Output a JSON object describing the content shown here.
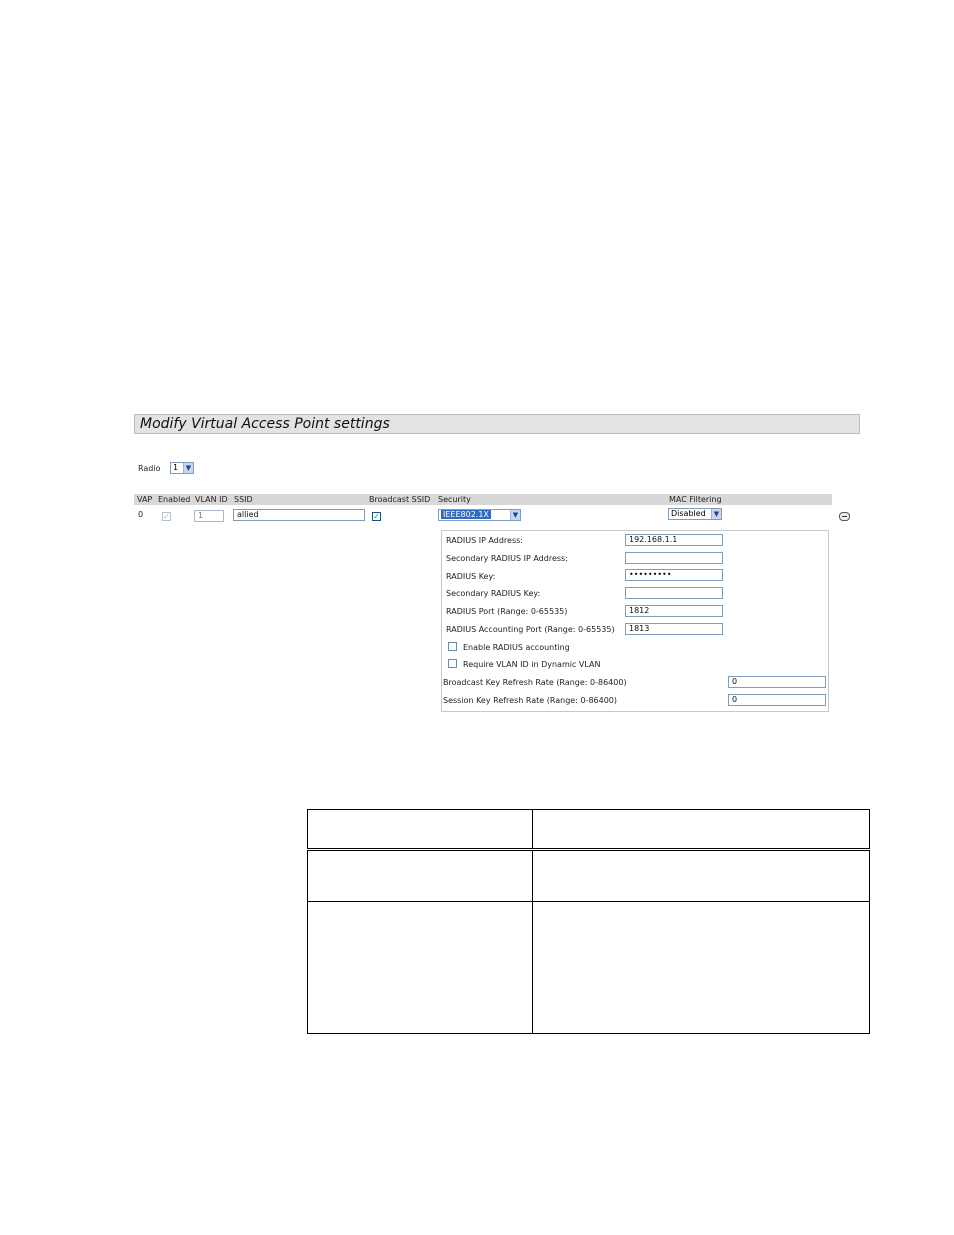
{
  "panel": {
    "title": "Modify Virtual Access Point settings",
    "radio_label": "Radio",
    "radio_value": "1"
  },
  "columns": {
    "vap": "VAP",
    "enabled": "Enabled",
    "vlan_id": "VLAN ID",
    "ssid": "SSID",
    "broadcast_ssid": "Broadcast SSID",
    "security": "Security",
    "mac_filtering": "MAC Filtering"
  },
  "row": {
    "vap": "0",
    "enabled_checked": true,
    "vlan_id": "1",
    "ssid": "allied",
    "broadcast_checked": true,
    "security": "IEEE802.1X",
    "mac_filtering": "Disabled"
  },
  "radius": {
    "ip_label": "RADIUS IP Address:",
    "ip_value": "192.168.1.1",
    "secondary_ip_label": "Secondary RADIUS IP Address:",
    "secondary_ip_value": "",
    "key_label": "RADIUS Key:",
    "key_value": "•••••••••",
    "secondary_key_label": "Secondary RADIUS Key:",
    "secondary_key_value": "",
    "port_label": "RADIUS Port (Range: 0-65535)",
    "port_value": "1812",
    "acct_port_label": "RADIUS Accounting Port (Range: 0-65535)",
    "acct_port_value": "1813",
    "enable_accounting_label": "Enable RADIUS accounting",
    "require_vlan_label": "Require VLAN ID in Dynamic VLAN",
    "bcast_key_label": "Broadcast Key Refresh Rate (Range: 0-86400)",
    "bcast_key_value": "0",
    "session_key_label": "Session Key Refresh Rate (Range: 0-86400)",
    "session_key_value": "0"
  },
  "icons": {
    "remove": "minus-circle-icon",
    "dropdown": "chevron-down-icon",
    "check": "check-icon"
  },
  "colors": {
    "title_bar": "#e3e3e3",
    "header_bar": "#d8d8d8",
    "selected": "#316ac5",
    "check": "#21a121"
  }
}
